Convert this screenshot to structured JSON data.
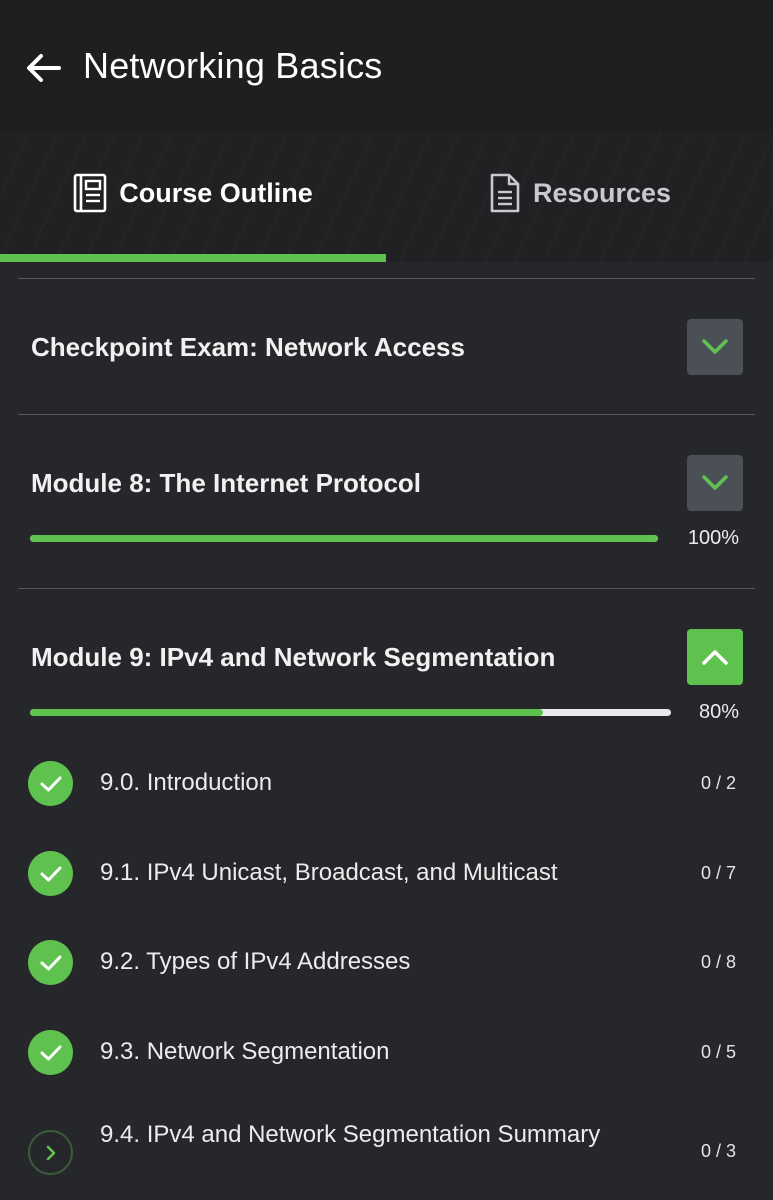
{
  "header": {
    "title": "Networking Basics",
    "back_icon": "arrow-left-icon"
  },
  "tabs": [
    {
      "label": "Course Outline",
      "icon": "book-outline-icon",
      "selected": true
    },
    {
      "label": "Resources",
      "icon": "document-icon",
      "selected": false
    }
  ],
  "colors": {
    "accent": "#5fc24e",
    "background": "#26272b",
    "header": "#1f1f21"
  },
  "modules": [
    {
      "title": "Checkpoint Exam: Network Access",
      "toggle_icon": "chevron-down-icon",
      "expanded": false
    },
    {
      "title": "Module 8: The Internet Protocol",
      "toggle_icon": "chevron-down-icon",
      "expanded": false,
      "progress_label": "100%",
      "progress": 1.0
    },
    {
      "title": "Module 9: IPv4 and Network Segmentation",
      "toggle_icon": "chevron-up-icon",
      "expanded": true,
      "progress_label": "80%",
      "progress": 0.8
    }
  ],
  "lessons": [
    {
      "label": "9.0. Introduction",
      "count": "0 / 2",
      "status": "complete",
      "icon": "check-circle-icon"
    },
    {
      "label": "9.1. IPv4 Unicast, Broadcast, and Multicast",
      "count": "0 / 7",
      "status": "complete",
      "icon": "check-circle-icon"
    },
    {
      "label": "9.2. Types of IPv4 Addresses",
      "count": "0 / 8",
      "status": "complete",
      "icon": "check-circle-icon"
    },
    {
      "label": "9.3. Network Segmentation",
      "count": "0 / 5",
      "status": "complete",
      "icon": "check-circle-icon"
    },
    {
      "label": "9.4. IPv4 and Network Segmentation Summary",
      "count": "0 / 3",
      "status": "in-progress",
      "icon": "chevron-right-circle-icon"
    }
  ]
}
